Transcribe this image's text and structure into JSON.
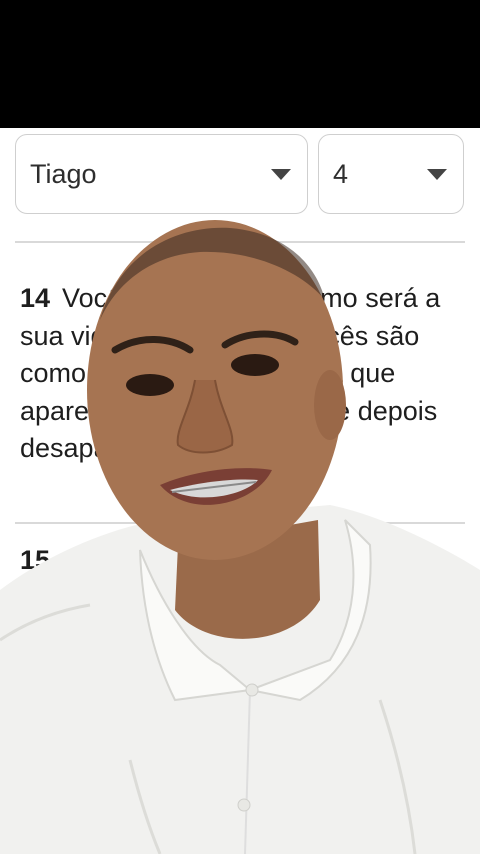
{
  "selectors": {
    "book": "Tiago",
    "chapter": "4"
  },
  "verses": [
    {
      "number": "14",
      "text": "Vocês nem sabem como será a sua vida amanhã, pois vocês são como a neblina passageira que aparece por algum tempo e depois desaparece."
    },
    {
      "number": "15",
      "text": ""
    }
  ],
  "colors": {
    "top_bar": "#000000",
    "shirt": "#f1f1ef",
    "skin": "#a67452",
    "border": "#cfcfcf"
  },
  "icons": {
    "dropdown": "chevron-down-icon"
  }
}
